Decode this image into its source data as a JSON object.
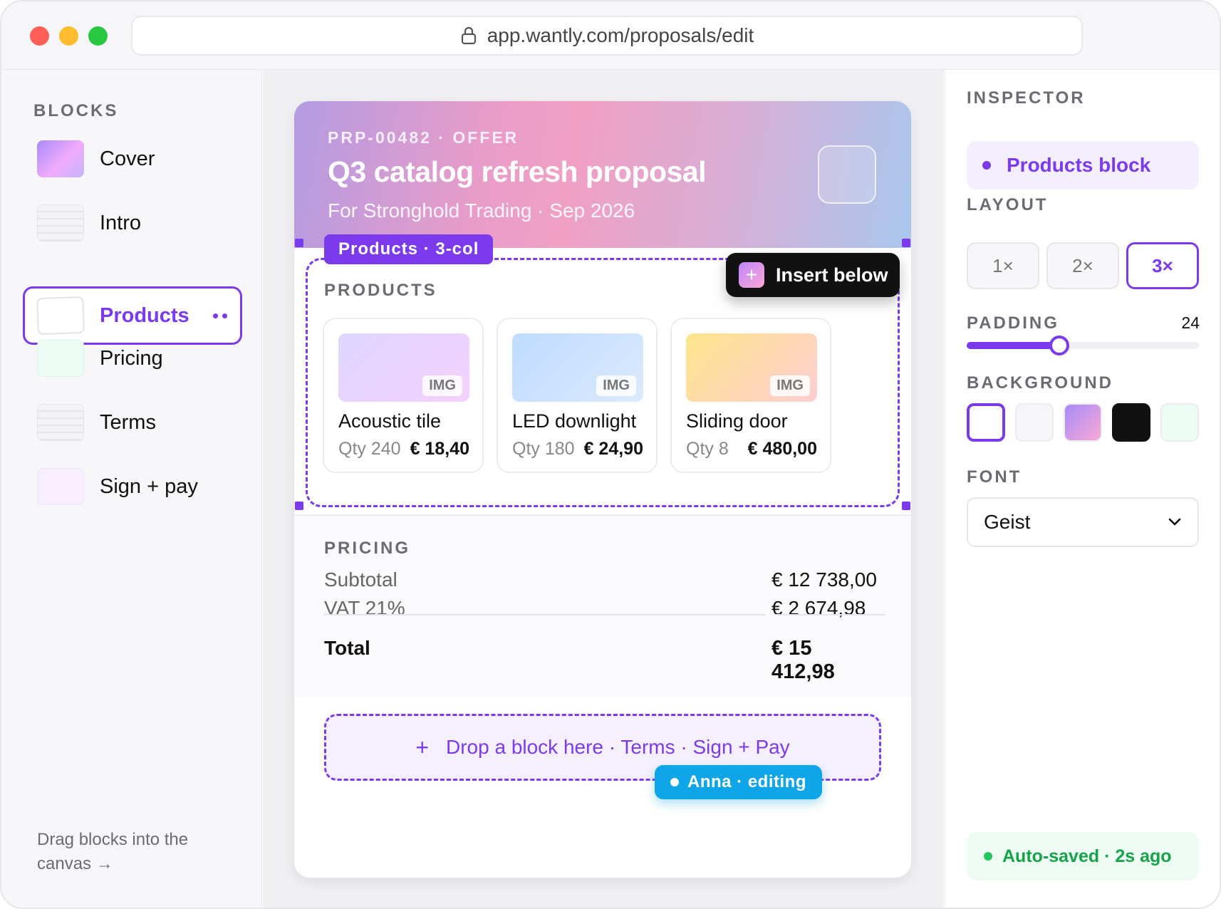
{
  "browser": {
    "url": "app.wantly.com/proposals/edit"
  },
  "sidebar": {
    "heading": "BLOCKS",
    "items": [
      {
        "label": "Cover"
      },
      {
        "label": "Intro"
      },
      {
        "label": "Products"
      },
      {
        "label": "Pricing"
      },
      {
        "label": "Terms"
      },
      {
        "label": "Sign + pay"
      }
    ],
    "hint": "Drag blocks into the canvas →"
  },
  "doc": {
    "cover": {
      "eyebrow": "PRP-00482 · OFFER",
      "title": "Q3 catalog refresh proposal",
      "subtitle": "For Stronghold Trading · Sep 2026"
    },
    "selection_tag": "Products · 3-col",
    "insert_label": "Insert below",
    "products": {
      "heading": "PRODUCTS",
      "img_tag": "IMG",
      "items": [
        {
          "name": "Acoustic tile",
          "qty": "Qty 240",
          "price": "€ 18,40"
        },
        {
          "name": "LED downlight",
          "qty": "Qty 180",
          "price": "€ 24,90"
        },
        {
          "name": "Sliding door",
          "qty": "Qty 8",
          "price": "€ 480,00"
        }
      ]
    },
    "pricing": {
      "heading": "PRICING",
      "rows": [
        {
          "label": "Subtotal",
          "value": "€ 12 738,00"
        },
        {
          "label": "VAT 21%",
          "value": "€ 2 674,98"
        }
      ],
      "total": {
        "label": "Total",
        "value": "€ 15 412,98"
      }
    },
    "dropzone": "Drop a block here · Terms · Sign + Pay",
    "presence": "Anna · editing"
  },
  "inspector": {
    "heading": "INSPECTOR",
    "selected": "Products block",
    "layout": {
      "label": "LAYOUT",
      "options": [
        "1×",
        "2×",
        "3×"
      ],
      "selected": "3×"
    },
    "padding": {
      "label": "PADDING",
      "value": "24",
      "fraction": 0.4
    },
    "background": {
      "label": "BACKGROUND",
      "swatches": [
        "#ffffff",
        "#f6f6f8",
        "gradient",
        "#111111",
        "#ecfdf5"
      ],
      "selected": "#ffffff"
    },
    "font": {
      "label": "FONT",
      "value": "Geist"
    },
    "autosave": "Auto-saved · 2s ago"
  },
  "colors": {
    "accent": "#7c3aed",
    "presence": "#0ea5e9",
    "success": "#16a34a"
  }
}
